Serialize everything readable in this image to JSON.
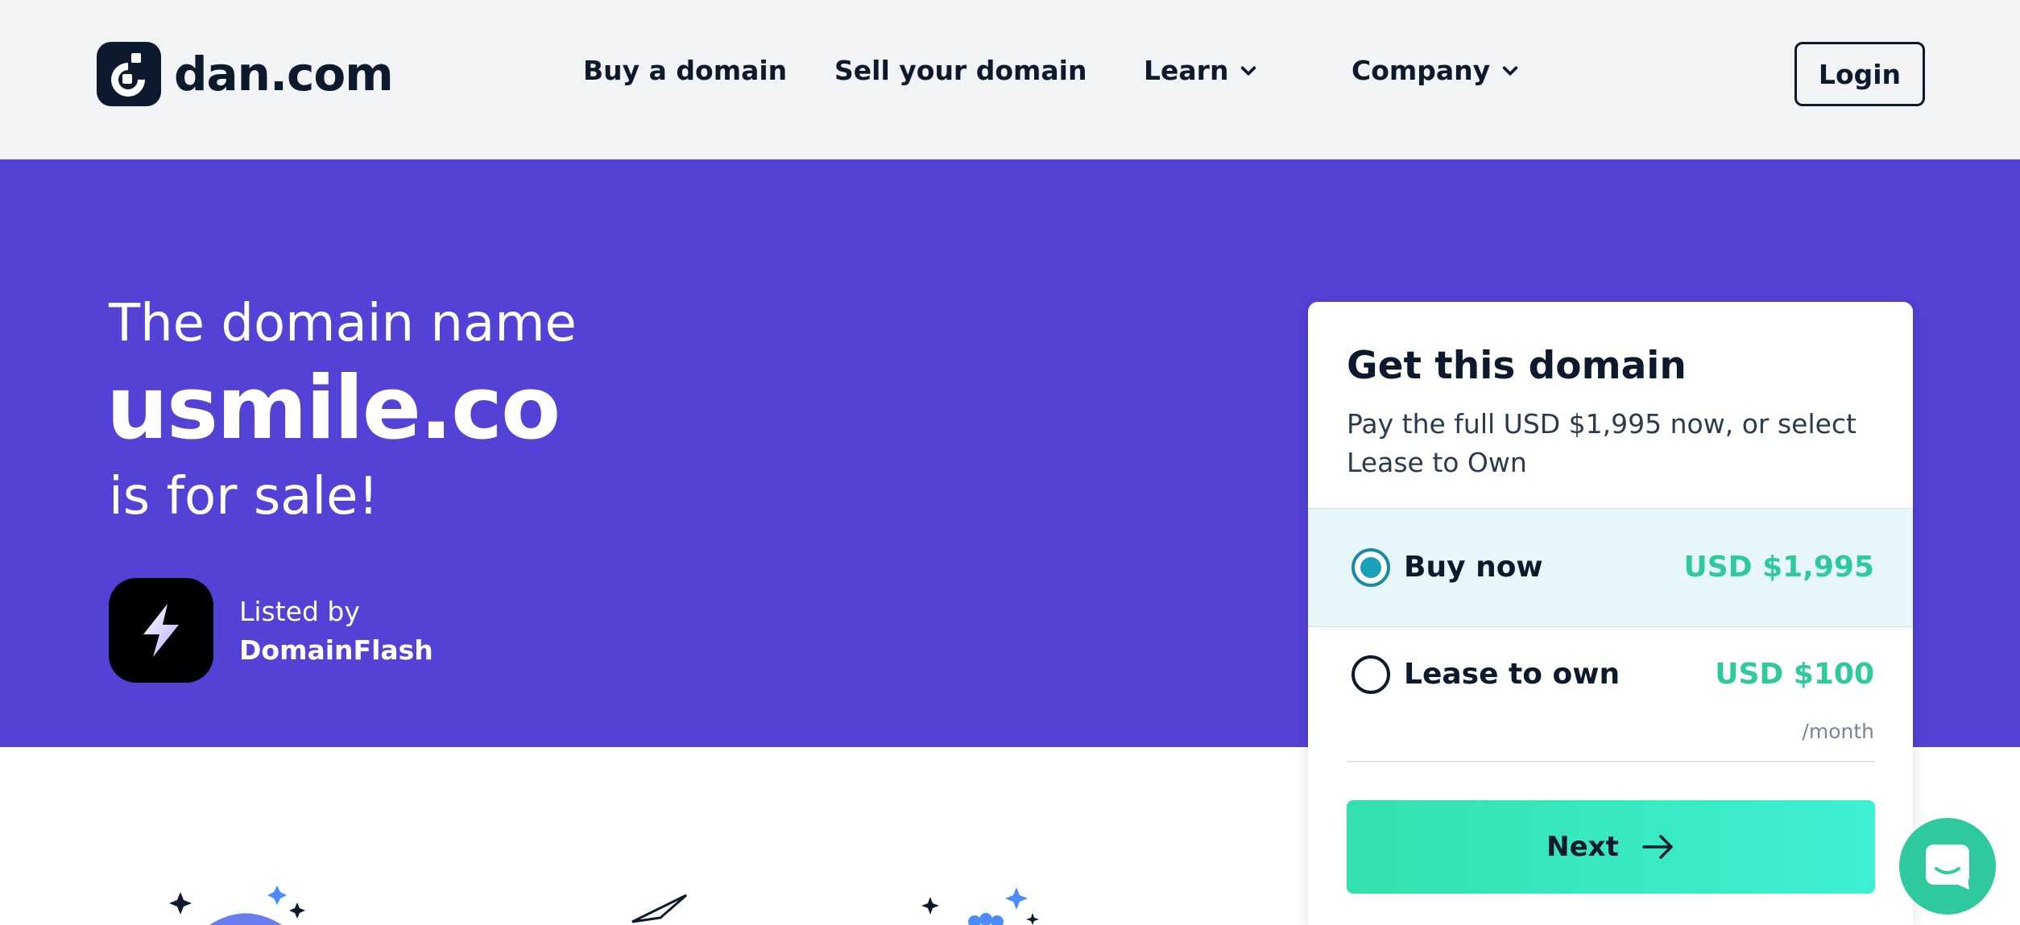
{
  "header": {
    "logo_text": "dan.com",
    "nav": {
      "buy": "Buy a domain",
      "sell": "Sell your domain",
      "learn": "Learn",
      "company": "Company"
    },
    "login_label": "Login"
  },
  "hero": {
    "line1": "The domain name",
    "domain": "usmile.co",
    "line3": "is for sale!",
    "listed_by_label": "Listed by",
    "seller_name": "DomainFlash"
  },
  "card": {
    "title": "Get this domain",
    "subtitle": "Pay the full USD $1,995 now, or select Lease to Own",
    "options": [
      {
        "label": "Buy now",
        "price": "USD $1,995",
        "selected": true
      },
      {
        "label": "Lease to own",
        "price": "USD $100",
        "period": "/month",
        "selected": false
      }
    ],
    "next_label": "Next"
  },
  "colors": {
    "hero_bg": "#5441d6",
    "brand_dark": "#0d1a2e",
    "price_green": "#2ec99c",
    "selected_bg": "#e6f6f9"
  },
  "icons": {
    "logo": "dan-logo-icon",
    "chevron": "chevron-down-icon",
    "seller": "lightning-bolt-icon",
    "next": "arrow-right-icon",
    "chat": "chat-icon"
  }
}
